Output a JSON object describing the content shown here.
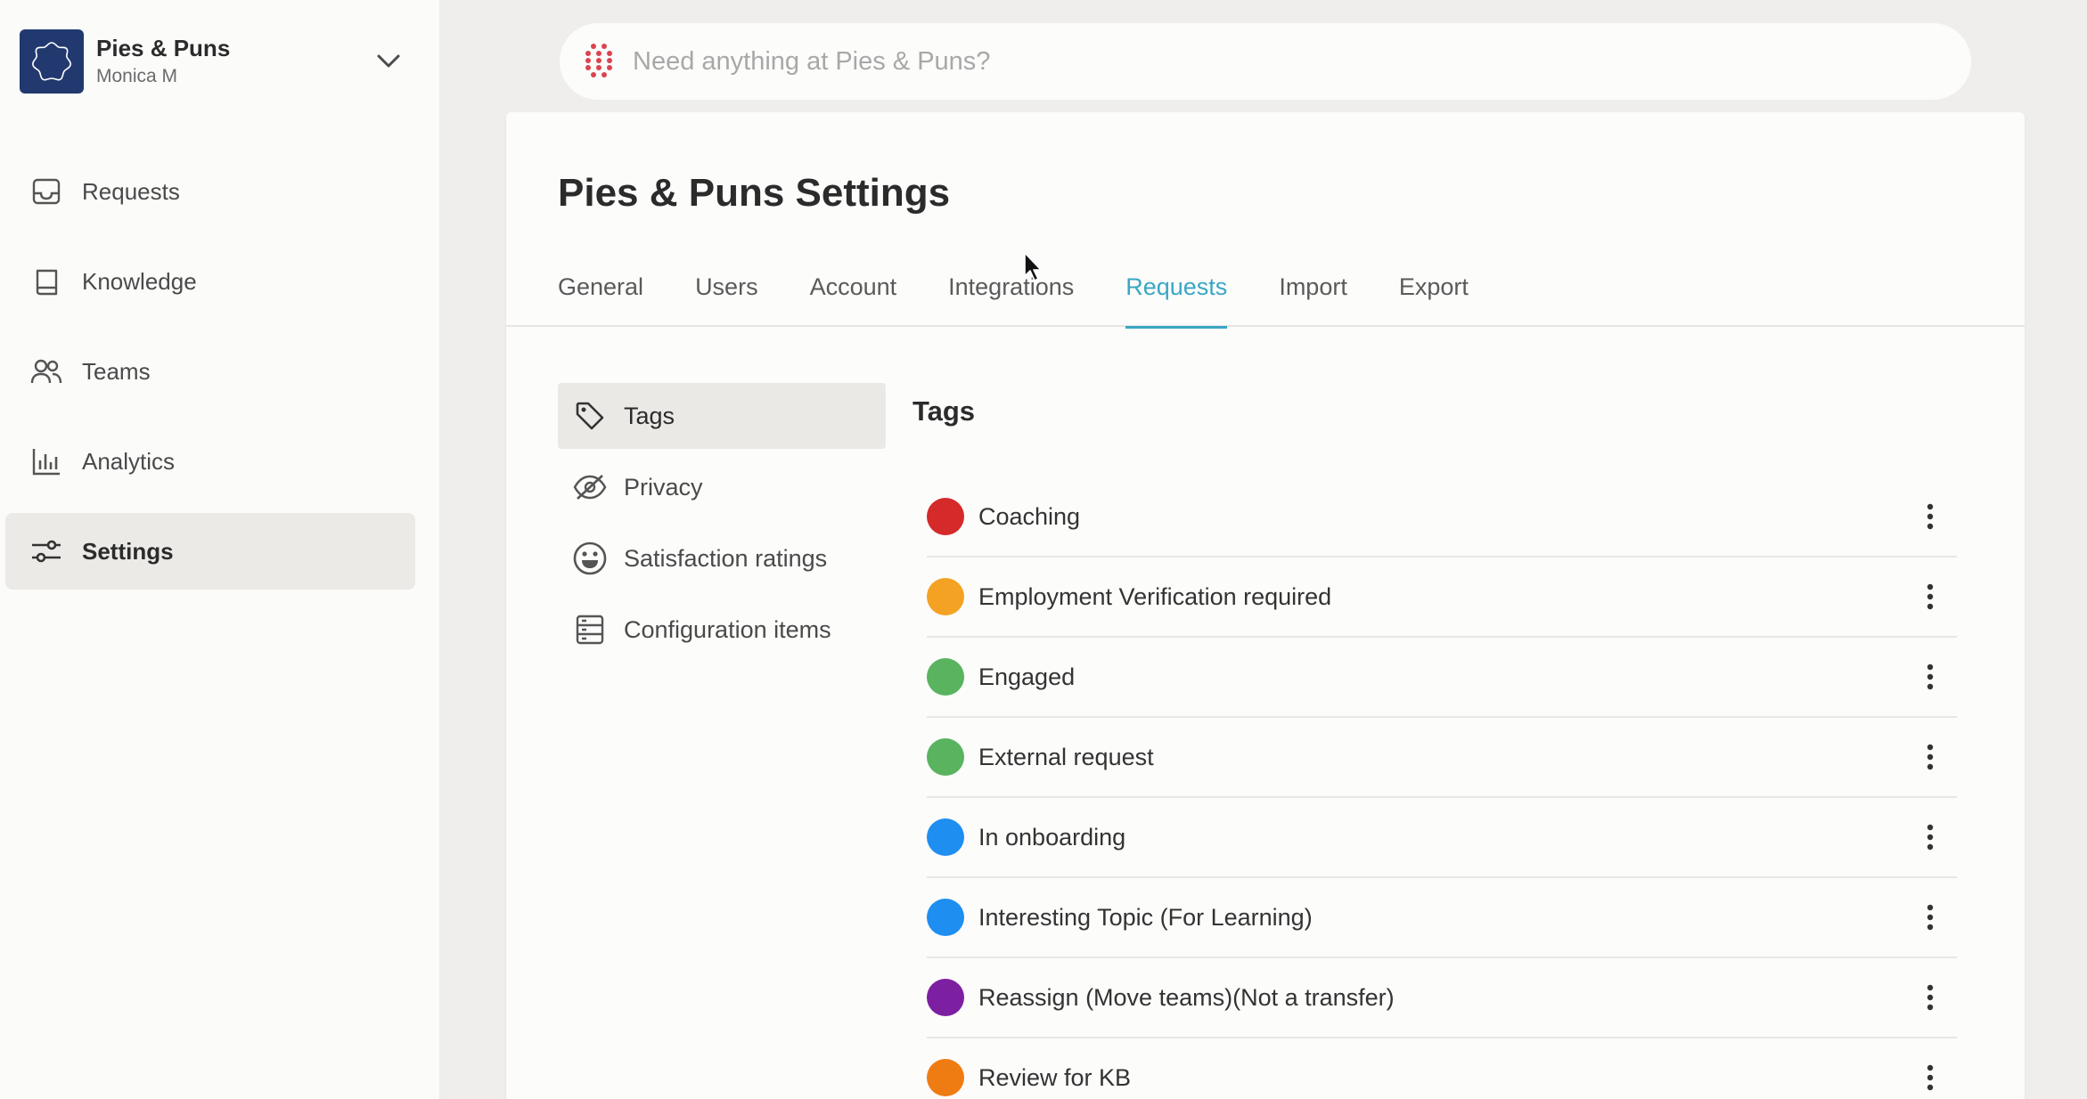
{
  "workspace": {
    "name": "Pies & Puns",
    "user": "Monica M"
  },
  "sidebar": {
    "items": [
      {
        "label": "Requests",
        "icon": "inbox-icon"
      },
      {
        "label": "Knowledge",
        "icon": "book-icon"
      },
      {
        "label": "Teams",
        "icon": "people-icon"
      },
      {
        "label": "Analytics",
        "icon": "bar-chart-icon"
      },
      {
        "label": "Settings",
        "icon": "sliders-icon",
        "active": true
      }
    ]
  },
  "search": {
    "placeholder": "Need anything at Pies & Puns?"
  },
  "page": {
    "title_strong": "Pies & Puns",
    "title_rest": " Settings"
  },
  "tabs": [
    {
      "label": "General"
    },
    {
      "label": "Users"
    },
    {
      "label": "Account"
    },
    {
      "label": "Integrations"
    },
    {
      "label": "Requests",
      "active": true
    },
    {
      "label": "Import"
    },
    {
      "label": "Export"
    }
  ],
  "subnav": [
    {
      "label": "Tags",
      "icon": "tag-icon",
      "active": true
    },
    {
      "label": "Privacy",
      "icon": "eye-off-icon"
    },
    {
      "label": "Satisfaction ratings",
      "icon": "smiley-icon"
    },
    {
      "label": "Configuration items",
      "icon": "server-icon"
    }
  ],
  "tags_section": {
    "heading": "Tags"
  },
  "tags": [
    {
      "label": "Coaching",
      "color": "#d42a2a"
    },
    {
      "label": "Employment Verification required",
      "color": "#f4a223"
    },
    {
      "label": "Engaged",
      "color": "#59b35f"
    },
    {
      "label": "External request",
      "color": "#59b35f"
    },
    {
      "label": "In onboarding",
      "color": "#1f8ef1"
    },
    {
      "label": "Interesting Topic (For Learning)",
      "color": "#1f8ef1"
    },
    {
      "label": "Reassign (Move teams)(Not a transfer)",
      "color": "#7d1fa1"
    },
    {
      "label": "Review for KB",
      "color": "#ef7c12"
    }
  ],
  "colors": {
    "accent": "#3aa6c4",
    "brand": "#22396f",
    "search_dots": "#d9454f"
  }
}
